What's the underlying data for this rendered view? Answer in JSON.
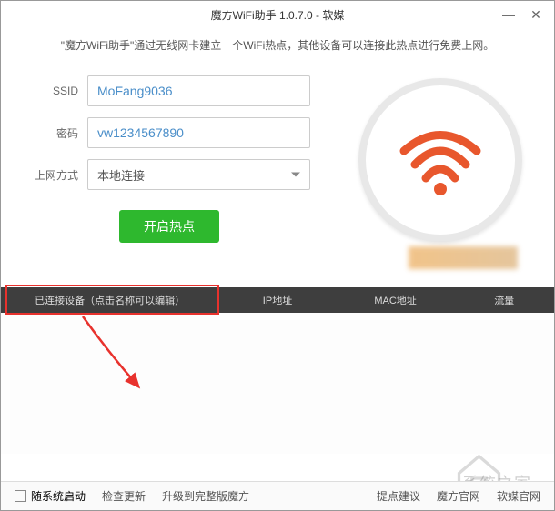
{
  "window": {
    "title": "魔方WiFi助手 1.0.7.0 - 软媒"
  },
  "description": "\"魔方WiFi助手\"通过无线网卡建立一个WiFi热点，其他设备可以连接此热点进行免费上网。",
  "form": {
    "ssid_label": "SSID",
    "ssid_value": "MoFang9036",
    "password_label": "密码",
    "password_value": "vw1234567890",
    "method_label": "上网方式",
    "method_value": "本地连接"
  },
  "buttons": {
    "start": "开启热点"
  },
  "table": {
    "headers": {
      "device": "已连接设备（点击名称可以编辑）",
      "ip": "IP地址",
      "mac": "MAC地址",
      "traffic": "流量"
    }
  },
  "footer": {
    "autostart": "随系统启动",
    "check_update": "检查更新",
    "upgrade": "升级到完整版魔方",
    "suggest": "提点建议",
    "official1": "魔方官网",
    "official2": "软媒官网"
  },
  "watermark_text": "系统之家"
}
